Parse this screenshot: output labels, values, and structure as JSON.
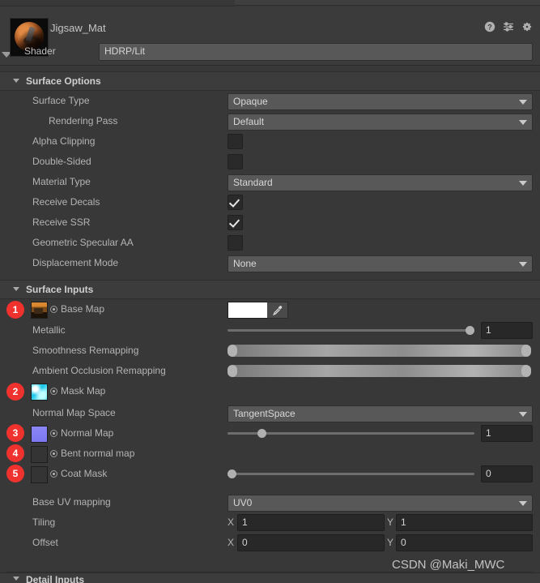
{
  "header": {
    "material_name": "Jigsaw_Mat",
    "shader_label": "Shader",
    "shader_value": "HDRP/Lit",
    "icons": [
      "help-icon",
      "preset-icon",
      "gear-icon"
    ]
  },
  "surface_options": {
    "title": "Surface Options",
    "rows": [
      {
        "label": "Surface Type",
        "type": "popup",
        "value": "Opaque"
      },
      {
        "label": "Rendering Pass",
        "type": "popup",
        "value": "Default",
        "indent": true
      },
      {
        "label": "Alpha Clipping",
        "type": "checkbox",
        "value": false
      },
      {
        "label": "Double-Sided",
        "type": "checkbox",
        "value": false
      },
      {
        "label": "Material Type",
        "type": "popup",
        "value": "Standard"
      },
      {
        "label": "Receive Decals",
        "type": "checkbox",
        "value": true
      },
      {
        "label": "Receive SSR",
        "type": "checkbox",
        "value": true
      },
      {
        "label": "Geometric Specular AA",
        "type": "checkbox",
        "value": false
      },
      {
        "label": "Displacement Mode",
        "type": "popup",
        "value": "None"
      }
    ]
  },
  "surface_inputs": {
    "title": "Surface Inputs",
    "rows": [
      {
        "label": "Base Map",
        "type": "texture-color",
        "badge": "1",
        "thumb": "base",
        "color": "#ffffff"
      },
      {
        "label": "Metallic",
        "type": "slider",
        "value": "1",
        "fill": 0.98
      },
      {
        "label": "Smoothness Remapping",
        "type": "remap",
        "min": "0",
        "max": "1"
      },
      {
        "label": "Ambient Occlusion Remapping",
        "type": "remap",
        "min": "0",
        "max": "1"
      },
      {
        "label": "Mask Map",
        "type": "texture",
        "badge": "2",
        "thumb": "mask"
      },
      {
        "label": "Normal Map Space",
        "type": "popup",
        "value": "TangentSpace"
      },
      {
        "label": "Normal Map",
        "type": "texture-slider",
        "badge": "3",
        "thumb": "normal",
        "value": "1",
        "fill": 0.125
      },
      {
        "label": "Bent normal map",
        "type": "texture",
        "badge": "4",
        "thumb": "empty"
      },
      {
        "label": "Coat Mask",
        "type": "texture-slider",
        "badge": "5",
        "thumb": "empty",
        "value": "0",
        "fill": 0.0
      },
      {
        "label": "Base UV mapping",
        "type": "popup",
        "value": "UV0"
      },
      {
        "label": "Tiling",
        "type": "vector2",
        "x_label": "X",
        "x": "1",
        "y_label": "Y",
        "y": "1"
      },
      {
        "label": "Offset",
        "type": "vector2",
        "x_label": "X",
        "x": "0",
        "y_label": "Y",
        "y": "0"
      }
    ]
  },
  "detail_inputs": {
    "title": "Detail Inputs"
  },
  "watermark": "CSDN @Maki_MWC",
  "colors": {
    "badge": "#f0322e",
    "panel": "#383838",
    "field": "#585858",
    "accent": "#ffffff"
  }
}
